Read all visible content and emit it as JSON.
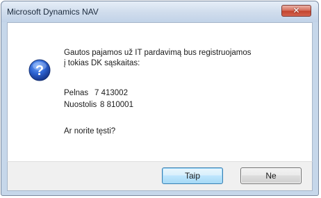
{
  "window": {
    "title": "Microsoft Dynamics NAV",
    "close_glyph": "✕"
  },
  "message": {
    "line1": "Gautos pajamos už IT pardavimą bus registruojamos",
    "line2": "į tokias DK sąskaitas:",
    "accounts": [
      {
        "label": "Pelnas",
        "value": "7 413002"
      },
      {
        "label": "Nuostolis",
        "value": "8 810001"
      }
    ],
    "question": "Ar norite tęsti?"
  },
  "buttons": {
    "yes_label": "Taip",
    "no_label": "Ne"
  },
  "icons": {
    "message_icon": "question-icon",
    "close_icon": "close-icon"
  }
}
